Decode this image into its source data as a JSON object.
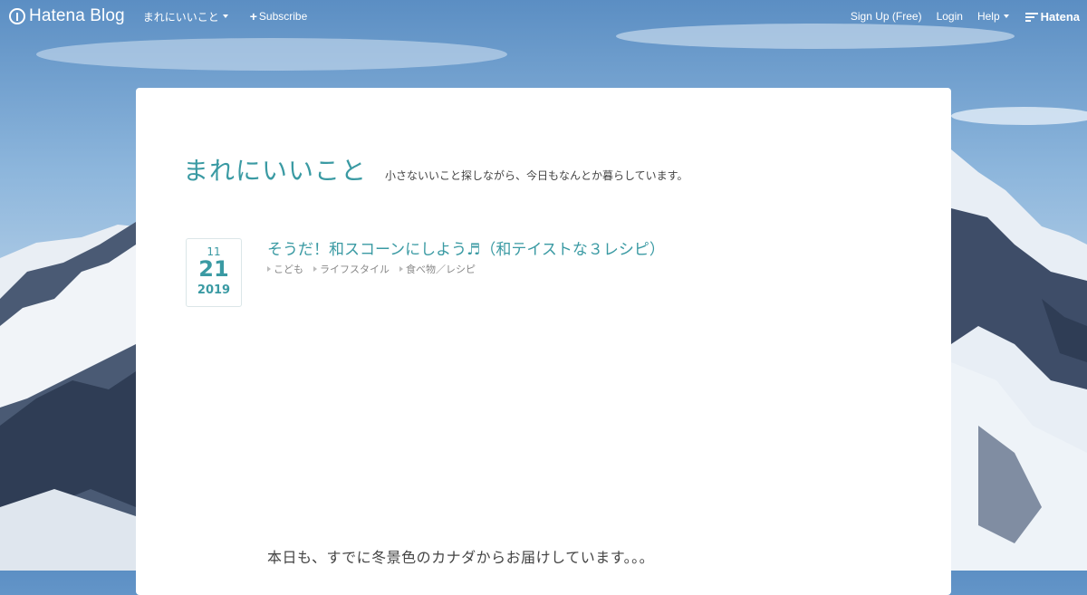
{
  "header": {
    "logo_text": "Hatena Blog",
    "blog_menu_label": "まれにいいこと",
    "subscribe_label": "Subscribe",
    "signup_label": "Sign Up (Free)",
    "login_label": "Login",
    "help_label": "Help",
    "hatena_label": "Hatena"
  },
  "blog": {
    "title": "まれにいいこと",
    "description": "小さないいこと探しながら、今日もなんとか暮らしています。"
  },
  "entry": {
    "date": {
      "month": "11",
      "day": "21",
      "year": "2019"
    },
    "title": "そうだ！和スコーンにしよう♬（和テイストな３レシピ）",
    "categories": [
      "こども",
      "ライフスタイル",
      "食べ物／レシピ"
    ],
    "first_line": "本日も、すでに冬景色のカナダからお届けしています。。。"
  },
  "colors": {
    "accent": "#3a9aa3",
    "text": "#444444",
    "muted": "#888888"
  }
}
